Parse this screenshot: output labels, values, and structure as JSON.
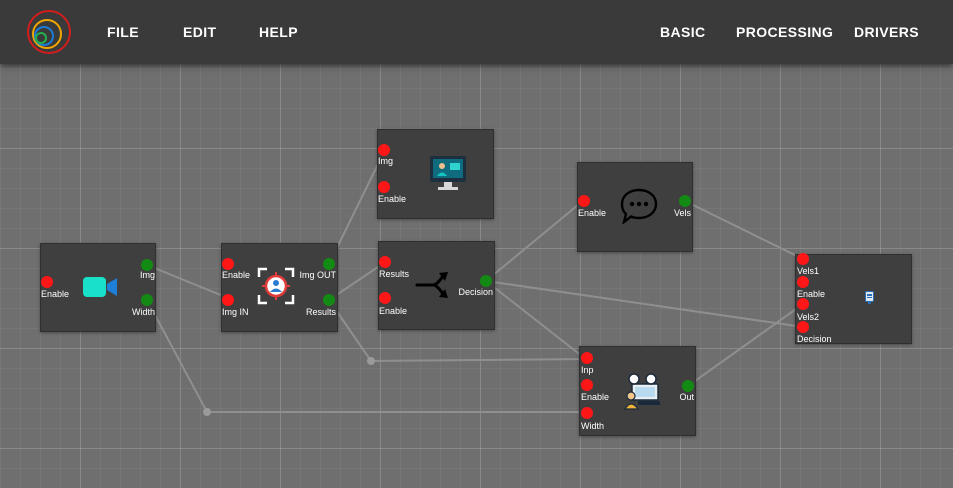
{
  "menu": {
    "file": "FILE",
    "edit": "EDIT",
    "help": "HELP",
    "basic": "BASIC",
    "processing": "PROCESSING",
    "drivers": "DRIVERS"
  },
  "colors": {
    "input_port": "#ff1616",
    "output_port": "#138a13",
    "node_bg": "#3f3f3f",
    "topbar": "#3a3a3a",
    "wire": "#8f8f8f"
  },
  "nodes": {
    "camera": {
      "icon": "video-camera-icon",
      "ports": {
        "enable": "Enable",
        "img": "Img",
        "width": "Width"
      }
    },
    "face": {
      "icon": "face-detection-icon",
      "ports": {
        "enable": "Enable",
        "img_in": "Img IN",
        "img_out": "Img OUT",
        "results": "Results"
      }
    },
    "display": {
      "icon": "monitor-display-icon",
      "ports": {
        "img": "Img",
        "enable": "Enable"
      }
    },
    "decision": {
      "icon": "fork-arrow-icon",
      "ports": {
        "results": "Results",
        "enable": "Enable",
        "decision": "Decision"
      }
    },
    "chat": {
      "icon": "speech-bubble-icon",
      "ports": {
        "enable": "Enable",
        "vels": "Vels"
      }
    },
    "processor": {
      "icon": "robot-controller-icon",
      "ports": {
        "inp": "Inp",
        "enable": "Enable",
        "width": "Width",
        "out": "Out"
      }
    },
    "driver": {
      "icon": "device-driver-icon",
      "ports": {
        "vels1": "Vels1",
        "enable": "Enable",
        "vels2": "Vels2",
        "decision": "Decision"
      }
    }
  }
}
